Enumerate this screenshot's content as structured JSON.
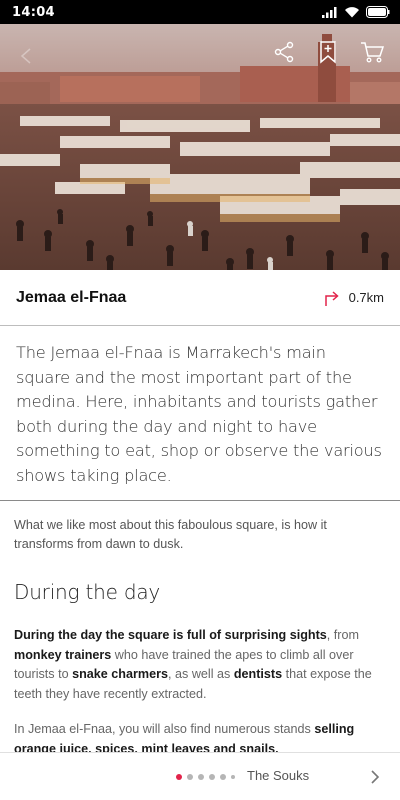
{
  "status_bar": {
    "time": "14:04"
  },
  "hero": {
    "image_description": "",
    "icons": [
      "back-icon",
      "share-icon",
      "bookmark-icon",
      "cart-icon"
    ]
  },
  "place": {
    "title": "Jemaa el-Fnaa",
    "distance": "0.7km",
    "accent_color": "#e2234a"
  },
  "intro_text": "The Jemaa el-Fnaa is Marrakech's main square and the most important part of the medina. Here, inhabitants and tourists gather both during the day and night to have something to eat, shop or observe the various shows taking place.",
  "content": {
    "lead": "What we like most about this faboulous square, is how it transforms from dawn to dusk.",
    "section_title": "During the day",
    "para1": {
      "part1": "During the day the square is full of surprising sights",
      "part2": ", from ",
      "part3": "monkey trainers",
      "part4": " who have trained the apes to climb all over tourists to ",
      "part5": "snake charmers",
      "part6": ", as well as ",
      "part7": "dentists",
      "part8": " that expose the teeth they have recently extracted."
    },
    "para2": {
      "part1": "In Jemaa el-Fnaa, you will also find numerous stands ",
      "part2": "selling orange juice, spices, mint leaves and snails."
    }
  },
  "bottom_nav": {
    "next_label": "The Souks",
    "page_count": 6,
    "active_page": 1
  }
}
